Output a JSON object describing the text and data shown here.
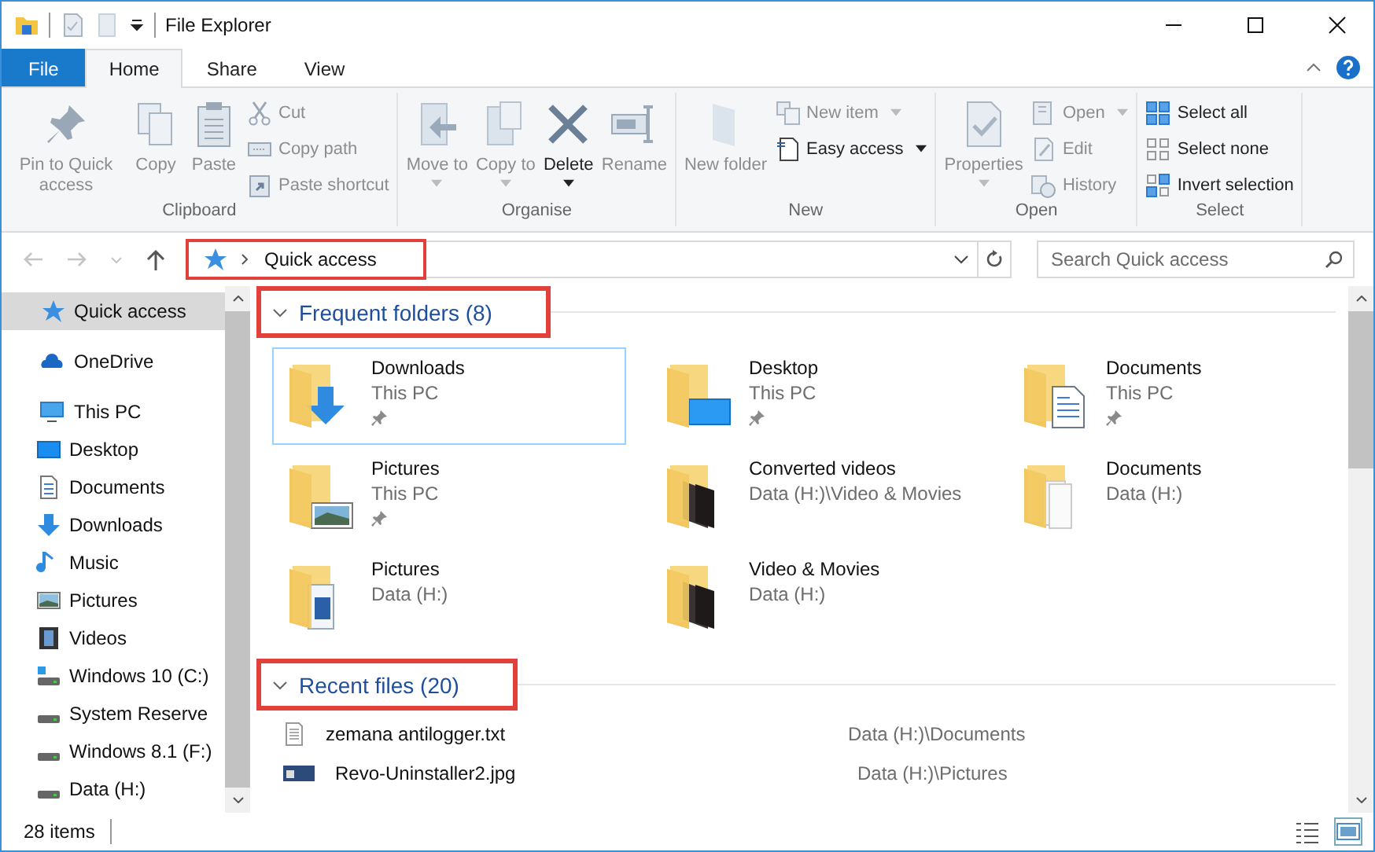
{
  "window": {
    "title": "File Explorer"
  },
  "ribbon_tabs": [
    {
      "label": "File",
      "kind": "file",
      "selected": false
    },
    {
      "label": "Home",
      "kind": "tab",
      "selected": true
    },
    {
      "label": "Share",
      "kind": "tab",
      "selected": false
    },
    {
      "label": "View",
      "kind": "tab",
      "selected": false
    }
  ],
  "ribbon_groups": [
    {
      "label": "Clipboard",
      "items": [
        {
          "label": "Pin to Quick access",
          "kind": "large",
          "disabled": true,
          "dropdown": false
        },
        {
          "label": "Copy",
          "kind": "large",
          "disabled": true,
          "dropdown": false
        },
        {
          "label": "Paste",
          "kind": "large",
          "disabled": true,
          "dropdown": false
        },
        {
          "label": "Cut",
          "kind": "small",
          "disabled": true,
          "dropdown": false
        },
        {
          "label": "Copy path",
          "kind": "small",
          "disabled": true,
          "dropdown": false
        },
        {
          "label": "Paste shortcut",
          "kind": "small",
          "disabled": true,
          "dropdown": false
        }
      ]
    },
    {
      "label": "Organise",
      "items": [
        {
          "label": "Move to",
          "kind": "large",
          "disabled": true,
          "dropdown": true
        },
        {
          "label": "Copy to",
          "kind": "large",
          "disabled": true,
          "dropdown": true
        },
        {
          "label": "Delete",
          "kind": "large",
          "disabled": false,
          "dropdown": true
        },
        {
          "label": "Rename",
          "kind": "large",
          "disabled": true,
          "dropdown": false
        }
      ]
    },
    {
      "label": "New",
      "items": [
        {
          "label": "New folder",
          "kind": "large",
          "disabled": true,
          "dropdown": false
        },
        {
          "label": "New item",
          "kind": "small",
          "disabled": true,
          "dropdown": true
        },
        {
          "label": "Easy access",
          "kind": "small",
          "disabled": false,
          "dropdown": true
        }
      ]
    },
    {
      "label": "Open",
      "items": [
        {
          "label": "Properties",
          "kind": "large",
          "disabled": true,
          "dropdown": true
        },
        {
          "label": "Open",
          "kind": "small",
          "disabled": true,
          "dropdown": true
        },
        {
          "label": "Edit",
          "kind": "small",
          "disabled": true,
          "dropdown": false
        },
        {
          "label": "History",
          "kind": "small",
          "disabled": true,
          "dropdown": false
        }
      ]
    },
    {
      "label": "Select",
      "items": [
        {
          "label": "Select all",
          "kind": "small",
          "disabled": false,
          "dropdown": false
        },
        {
          "label": "Select none",
          "kind": "small",
          "disabled": false,
          "dropdown": false
        },
        {
          "label": "Invert selection",
          "kind": "small",
          "disabled": false,
          "dropdown": false
        }
      ]
    }
  ],
  "address_bar": {
    "crumbs": [
      "Quick access"
    ],
    "highlighted": true
  },
  "search": {
    "placeholder": "Search Quick access"
  },
  "sidebar": {
    "items": [
      {
        "label": "Quick access",
        "kind": "quick",
        "selected": true
      },
      {
        "label": "OneDrive",
        "kind": "cloud",
        "selected": false
      },
      {
        "label": "This PC",
        "kind": "pc",
        "selected": false,
        "children": [
          {
            "label": "Desktop",
            "kind": "desktop",
            "selected": false
          },
          {
            "label": "Documents",
            "kind": "documents",
            "selected": false
          },
          {
            "label": "Downloads",
            "kind": "downloads",
            "selected": false
          },
          {
            "label": "Music",
            "kind": "music",
            "selected": false
          },
          {
            "label": "Pictures",
            "kind": "pictures",
            "selected": false
          },
          {
            "label": "Videos",
            "kind": "videos",
            "selected": false
          },
          {
            "label": "Windows 10 (C:)",
            "kind": "system-drive",
            "selected": false
          },
          {
            "label": "System Reserve",
            "kind": "drive",
            "selected": false
          },
          {
            "label": "Windows 8.1 (F:)",
            "kind": "drive",
            "selected": false
          },
          {
            "label": "Data (H:)",
            "kind": "drive",
            "selected": false
          }
        ]
      }
    ]
  },
  "frequent_folders": {
    "title": "Frequent folders (8)",
    "expanded": true,
    "highlighted": true,
    "items": [
      {
        "name": "Downloads",
        "location": "This PC",
        "kind": "downloads",
        "pinned": true,
        "selected": true
      },
      {
        "name": "Desktop",
        "location": "This PC",
        "kind": "desktop",
        "pinned": true,
        "selected": false
      },
      {
        "name": "Documents",
        "location": "This PC",
        "kind": "documents",
        "pinned": true,
        "selected": false
      },
      {
        "name": "Pictures",
        "location": "This PC",
        "kind": "pictures",
        "pinned": true,
        "selected": false
      },
      {
        "name": "Converted videos",
        "location": "Data (H:)\\Video & Movies",
        "kind": "videos",
        "pinned": false,
        "selected": false
      },
      {
        "name": "Documents",
        "location": "Data (H:)",
        "kind": "papers",
        "pinned": false,
        "selected": false
      },
      {
        "name": "Pictures",
        "location": "Data (H:)",
        "kind": "book",
        "pinned": false,
        "selected": false
      },
      {
        "name": "Video & Movies",
        "location": "Data (H:)",
        "kind": "videos",
        "pinned": false,
        "selected": false
      }
    ]
  },
  "recent_files": {
    "title": "Recent files (20)",
    "expanded": true,
    "highlighted": true,
    "items": [
      {
        "name": "zemana antilogger.txt",
        "location": "Data (H:)\\Documents",
        "kind": "text"
      },
      {
        "name": "Revo-Uninstaller2.jpg",
        "location": "Data (H:)\\Pictures",
        "kind": "image"
      }
    ]
  },
  "status_bar": {
    "count": "28 items"
  }
}
